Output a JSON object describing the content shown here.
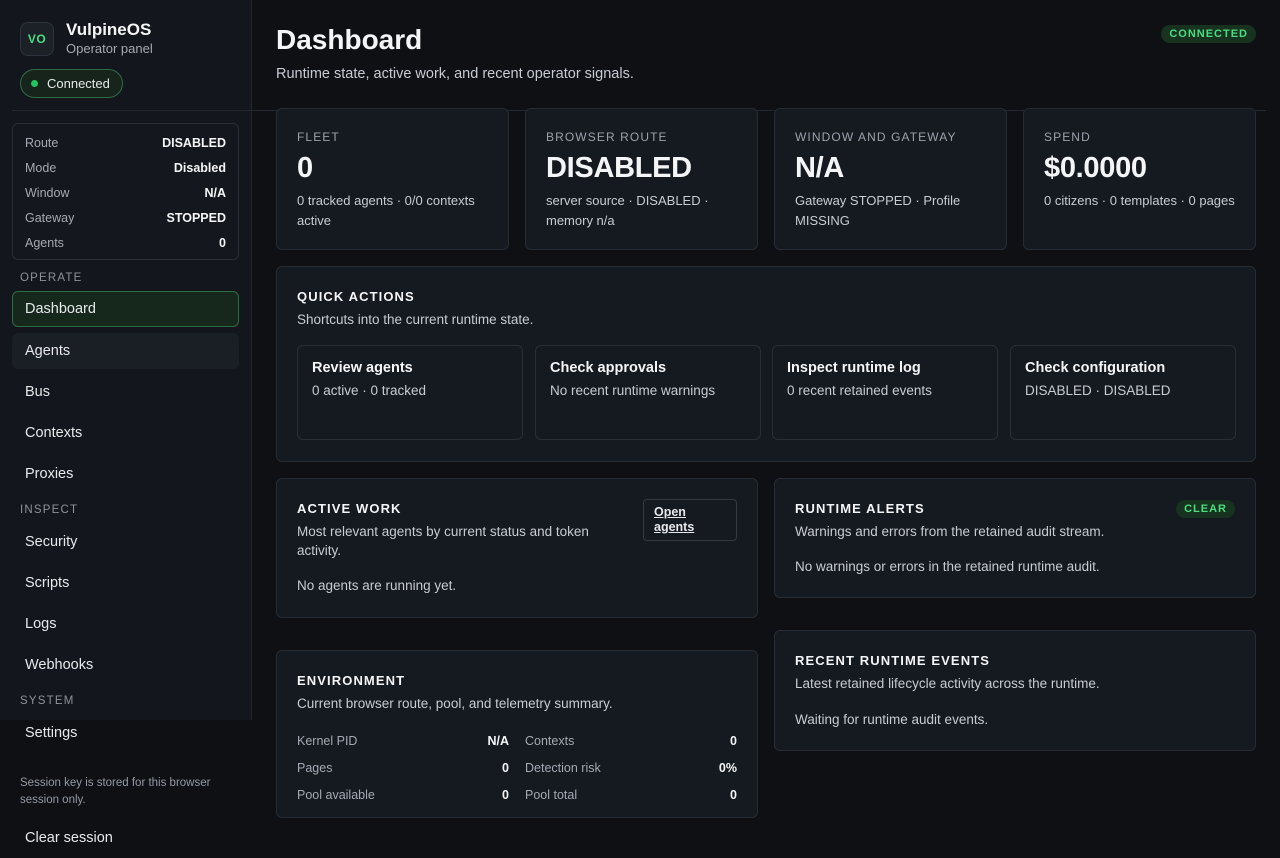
{
  "brand": {
    "logo": "VO",
    "name": "VulpineOS",
    "subtitle": "Operator panel"
  },
  "connection": {
    "label": "Connected",
    "badge": "CONNECTED"
  },
  "status": [
    {
      "key": "Route",
      "value": "DISABLED"
    },
    {
      "key": "Mode",
      "value": "Disabled"
    },
    {
      "key": "Window",
      "value": "N/A"
    },
    {
      "key": "Gateway",
      "value": "STOPPED"
    },
    {
      "key": "Agents",
      "value": "0"
    }
  ],
  "nav": {
    "operate_label": "OPERATE",
    "inspect_label": "INSPECT",
    "system_label": "SYSTEM",
    "dashboard": "Dashboard",
    "agents": "Agents",
    "bus": "Bus",
    "contexts": "Contexts",
    "proxies": "Proxies",
    "security": "Security",
    "scripts": "Scripts",
    "logs": "Logs",
    "webhooks": "Webhooks",
    "settings": "Settings",
    "clear_session": "Clear session"
  },
  "session_note": "Session key is stored for this browser session only.",
  "page": {
    "title": "Dashboard",
    "subtitle": "Runtime state, active work, and recent operator signals."
  },
  "stats": [
    {
      "label": "FLEET",
      "value": "0",
      "desc": "0 tracked agents · 0/0 contexts active"
    },
    {
      "label": "BROWSER ROUTE",
      "value": "DISABLED",
      "desc": "server source · DISABLED · memory n/a"
    },
    {
      "label": "WINDOW AND GATEWAY",
      "value": "N/A",
      "desc": "Gateway STOPPED · Profile MISSING"
    },
    {
      "label": "SPEND",
      "value": "$0.0000",
      "desc": "0 citizens · 0 templates · 0 pages"
    }
  ],
  "quick_actions": {
    "title": "QUICK ACTIONS",
    "desc": "Shortcuts into the current runtime state.",
    "items": [
      {
        "title": "Review agents",
        "desc": "0 active · 0 tracked"
      },
      {
        "title": "Check approvals",
        "desc": "No recent runtime warnings"
      },
      {
        "title": "Inspect runtime log",
        "desc": "0 recent retained events"
      },
      {
        "title": "Check configuration",
        "desc": "DISABLED · DISABLED"
      }
    ]
  },
  "active_work": {
    "title": "ACTIVE WORK",
    "desc": "Most relevant agents by current status and token activity.",
    "button": "Open agents",
    "empty": "No agents are running yet."
  },
  "runtime_alerts": {
    "title": "RUNTIME ALERTS",
    "badge": "CLEAR",
    "desc": "Warnings and errors from the retained audit stream.",
    "empty": "No warnings or errors in the retained runtime audit."
  },
  "environment": {
    "title": "ENVIRONMENT",
    "desc": "Current browser route, pool, and telemetry summary.",
    "rows": [
      [
        {
          "key": "Kernel PID",
          "value": "N/A"
        },
        {
          "key": "Contexts",
          "value": "0"
        }
      ],
      [
        {
          "key": "Pages",
          "value": "0"
        },
        {
          "key": "Detection risk",
          "value": "0%"
        }
      ],
      [
        {
          "key": "Pool available",
          "value": "0"
        },
        {
          "key": "Pool total",
          "value": "0"
        }
      ]
    ]
  },
  "recent_events": {
    "title": "RECENT RUNTIME EVENTS",
    "desc": "Latest retained lifecycle activity across the runtime.",
    "empty": "Waiting for runtime audit events."
  },
  "colors": {
    "accent": "#4ade80",
    "background": "#0e1014",
    "card": "#151920"
  }
}
